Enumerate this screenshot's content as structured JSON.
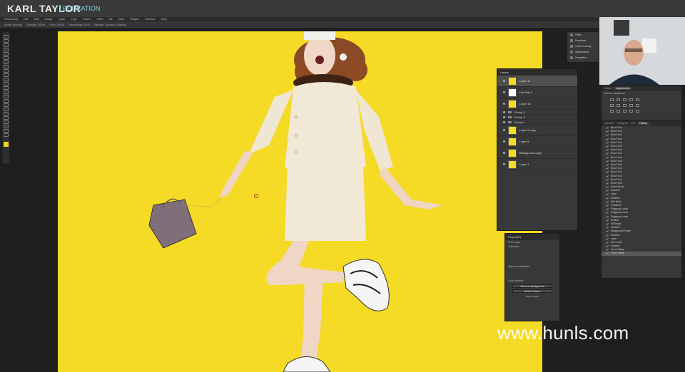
{
  "branding": {
    "name": "KARL TAYLOR",
    "sub": "EDUCATION"
  },
  "menu": {
    "items": [
      "Photoshop",
      "File",
      "Edit",
      "Image",
      "Layer",
      "Type",
      "Select",
      "Filter",
      "3D",
      "View",
      "Plugins",
      "Window",
      "Help"
    ]
  },
  "options": {
    "items": [
      "Mode: Normal",
      "Opacity: 100%",
      "Flow: 100%",
      "Smoothing: 10%",
      "Sample: Current & Below"
    ]
  },
  "layers_panel": {
    "title": "Layers",
    "rows": [
      {
        "name": "Layer 11",
        "type": "layer",
        "selected": true
      },
      {
        "name": "Hue/Sat 1",
        "type": "adjustment"
      },
      {
        "name": "Layer 10",
        "type": "layer"
      },
      {
        "name": "Group 3",
        "type": "group"
      },
      {
        "name": "Group 2",
        "type": "group"
      },
      {
        "name": "Group 1",
        "type": "group"
      },
      {
        "name": "Layer 9 copy",
        "type": "layer"
      },
      {
        "name": "Layer 9",
        "type": "layer"
      },
      {
        "name": "Background copy",
        "type": "layer"
      },
      {
        "name": "Layer 1",
        "type": "layer"
      }
    ]
  },
  "properties_panel": {
    "title": "Properties",
    "subtitle": "Pixel Layer",
    "sections": [
      "Transform",
      "Align and Distribute",
      "Quick Actions"
    ],
    "buttons": [
      "Remove Background",
      "Select Subject",
      "Learn more"
    ]
  },
  "mini_panel": {
    "items": [
      "Paths",
      "Swatches",
      "Colour Lookup",
      "Adjustments",
      "Properties"
    ]
  },
  "adjustments_panel": {
    "tabs": [
      "Colour",
      "Adjustments"
    ],
    "label": "Add an adjustment"
  },
  "history_panel": {
    "tabs": [
      "Libraries",
      "Histogram",
      "Info",
      "History"
    ],
    "active_tab": "History",
    "rows": [
      "Brush Tool",
      "Brush Tool",
      "Brush Tool",
      "Brush Tool",
      "Brush Tool",
      "Brush Tool",
      "Brush Tool",
      "Brush Tool",
      "Brush Tool",
      "Brush Tool",
      "Brush Tool",
      "Brush Tool",
      "Brush Tool",
      "Brush Tool",
      "Brush Tool",
      "Brush Tool",
      "Select Brush",
      "Deselect",
      "Layer",
      "Deselect",
      "Add Mask",
      "Transform",
      "Polygonal Lasso",
      "Polygonal Lasso",
      "Polygonal Lasso",
      "Feather",
      "Fill Shape",
      "Deselect",
      "Background Eraser",
      "Deselect",
      "Layer",
      "New Layer",
      "Deselect",
      "Clone Stamp",
      "Clone Stamp"
    ],
    "selected_index": 34
  },
  "watermark": {
    "text": "www.hunls.com"
  },
  "colors": {
    "canvas": "#f5db26",
    "ui_dark": "#383838"
  }
}
